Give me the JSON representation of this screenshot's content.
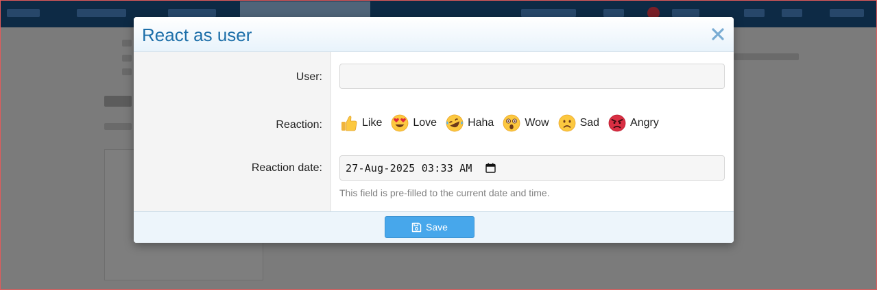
{
  "dialog": {
    "title": "React as user",
    "close_icon": "close-icon"
  },
  "form": {
    "user": {
      "label": "User:",
      "value": "",
      "placeholder": ""
    },
    "reaction": {
      "label": "Reaction:",
      "options": [
        {
          "label": "Like",
          "icon": "thumbs-up-icon"
        },
        {
          "label": "Love",
          "icon": "heart-eyes-icon"
        },
        {
          "label": "Haha",
          "icon": "laughing-icon"
        },
        {
          "label": "Wow",
          "icon": "astonished-icon"
        },
        {
          "label": "Sad",
          "icon": "sad-face-icon"
        },
        {
          "label": "Angry",
          "icon": "angry-face-icon"
        }
      ]
    },
    "reaction_date": {
      "label": "Reaction date:",
      "value": "27-Aug-2025 03:33  AM",
      "hint": "This field is pre-filled to the current date and time.",
      "icon": "calendar-icon"
    }
  },
  "footer": {
    "save_label": "Save",
    "save_icon": "save-icon"
  },
  "colors": {
    "title": "#1d6fa9",
    "save_button": "#47a7eb",
    "close_icon": "#79acd3"
  }
}
